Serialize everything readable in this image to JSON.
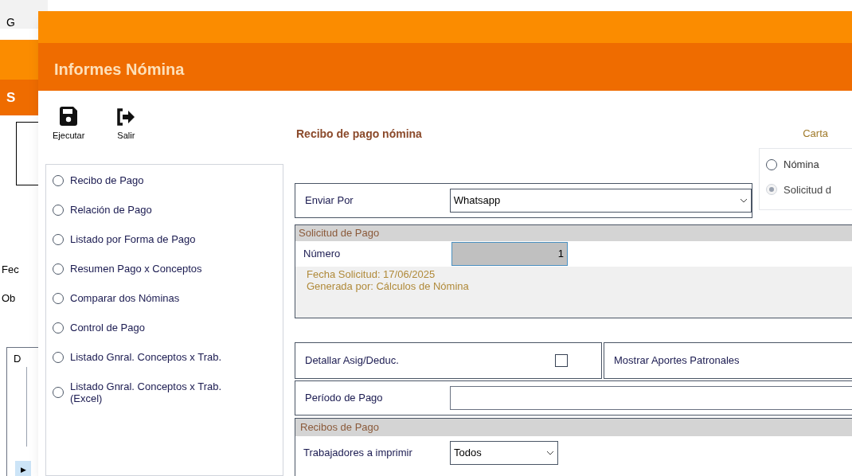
{
  "background_window": {
    "title": "G",
    "header": "S",
    "labels": [
      "Fec",
      "Ob"
    ],
    "table_header": "D",
    "row_marker": "▶"
  },
  "dialog": {
    "title": "Informes Nómina"
  },
  "toolbar": [
    {
      "kind": "save",
      "label": "Ejecutar"
    },
    {
      "kind": "exit",
      "label": "Salir"
    }
  ],
  "report_title": "Recibo de pago nómina",
  "format": "Carta",
  "reports": [
    {
      "label": "Recibo de Pago",
      "selected": false
    },
    {
      "label": "Relación de Pago",
      "selected": false
    },
    {
      "label": "Listado por Forma de Pago",
      "selected": false
    },
    {
      "label": "Resumen Pago x Conceptos",
      "selected": false
    },
    {
      "label": "Comparar dos Nóminas",
      "selected": false
    },
    {
      "label": "Control de Pago",
      "selected": false
    },
    {
      "label": "Listado Gnral. Conceptos x Trab.",
      "selected": false
    },
    {
      "label": "Listado Gnral. Conceptos x Trab. (Excel)",
      "selected": false
    }
  ],
  "source": [
    {
      "label": "Nómina",
      "selected": false
    },
    {
      "label": "Solicitud d",
      "selected": true
    }
  ],
  "send_by": {
    "label": "Enviar Por",
    "value": "Whatsapp"
  },
  "payment_request": {
    "header": "Solicitud de Pago",
    "number_label": "Número",
    "number": "1",
    "info": [
      "Fecha Solicitud: 17/06/2025",
      "Generada por: Cálculos de Nómina"
    ]
  },
  "detail": {
    "label": "Detallar Asig/Deduc.",
    "checked": false
  },
  "employer_contributions": {
    "label": "Mostrar Aportes Patronales"
  },
  "period": {
    "label": "Período de Pago"
  },
  "receipts": {
    "header": "Recibos de Pago",
    "workers_label": "Trabajadores a imprimir",
    "workers": "Todos"
  }
}
